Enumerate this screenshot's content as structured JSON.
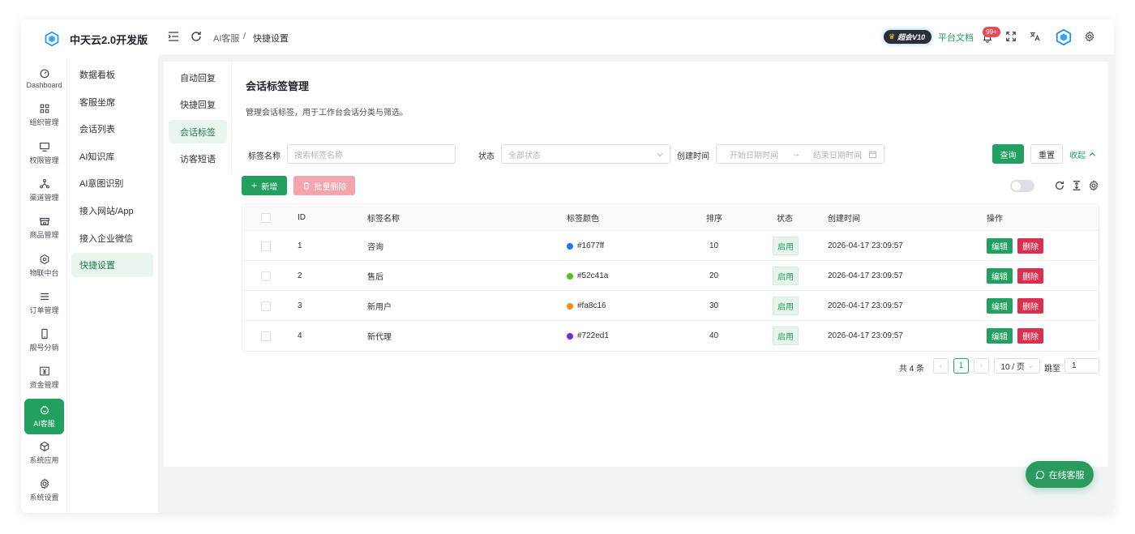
{
  "app": {
    "brand": "中天云2.0开发版"
  },
  "rail": {
    "items": [
      {
        "label": "Dashboard",
        "icon": "dashboard-icon"
      },
      {
        "label": "组织管理",
        "icon": "grid-icon"
      },
      {
        "label": "权限管理",
        "icon": "monitor-icon"
      },
      {
        "label": "渠道管理",
        "icon": "share-icon"
      },
      {
        "label": "商品管理",
        "icon": "store-icon"
      },
      {
        "label": "物联中台",
        "icon": "cube-icon"
      },
      {
        "label": "订单管理",
        "icon": "list-icon"
      },
      {
        "label": "靓号分销",
        "icon": "phone-icon"
      },
      {
        "label": "资金管理",
        "icon": "money-icon"
      },
      {
        "label": "AI客服",
        "icon": "ai-service-icon",
        "active": true
      },
      {
        "label": "系统应用",
        "icon": "box-icon"
      },
      {
        "label": "系统设置",
        "icon": "gear-icon"
      }
    ]
  },
  "submenu": {
    "items": [
      "数据看板",
      "客服坐席",
      "会话列表",
      "AI知识库",
      "AI意图识别",
      "接入网站/App",
      "接入企业微信",
      "快捷设置"
    ],
    "active_index": 7
  },
  "header": {
    "breadcrumb": [
      "AI客服",
      "/",
      "快捷设置"
    ],
    "vip_badge": "超会V10",
    "doc_link": "平台文档",
    "notif_count": "99+"
  },
  "inner_nav": {
    "items": [
      "自动回复",
      "快捷回复",
      "会话标签",
      "访客短语"
    ],
    "active_index": 2
  },
  "page": {
    "title": "会话标签管理",
    "description": "管理会话标签，用于工作台会话分类与筛选。"
  },
  "filters": {
    "name_label": "标签名称",
    "name_placeholder": "搜索标签名称",
    "status_label": "状态",
    "status_placeholder": "全部状态",
    "time_label": "创建时间",
    "start_placeholder": "开始日期时间",
    "arrow": "→",
    "end_placeholder": "结束日期时间",
    "query_button": "查询",
    "reset_button": "重置",
    "collapse_link": "收起"
  },
  "toolbar": {
    "add_button": "新增",
    "batch_delete_button": "批量删除"
  },
  "table": {
    "columns": [
      "ID",
      "标签名称",
      "标签颜色",
      "排序",
      "状态",
      "创建时间",
      "操作"
    ],
    "rows": [
      {
        "id": "1",
        "name": "咨询",
        "color": "#1677ff",
        "sort": "10",
        "status": "启用",
        "created": "2026-04-17 23:09:57"
      },
      {
        "id": "2",
        "name": "售后",
        "color": "#52c41a",
        "sort": "20",
        "status": "启用",
        "created": "2026-04-17 23:09:57"
      },
      {
        "id": "3",
        "name": "新用户",
        "color": "#fa8c16",
        "sort": "30",
        "status": "启用",
        "created": "2026-04-17 23:09:57"
      },
      {
        "id": "4",
        "name": "新代理",
        "color": "#722ed1",
        "sort": "40",
        "status": "启用",
        "created": "2026-04-17 23:09:57"
      }
    ],
    "edit_label": "编辑",
    "delete_label": "删除"
  },
  "pagination": {
    "total": "共 4 条",
    "current_page": "1",
    "page_size": "10 / 页",
    "jump_label": "跳至",
    "jump_value": "1"
  },
  "float": {
    "online_service": "在线客服"
  },
  "colors": {
    "primary": "#22a05f",
    "danger": "#d9304f"
  }
}
